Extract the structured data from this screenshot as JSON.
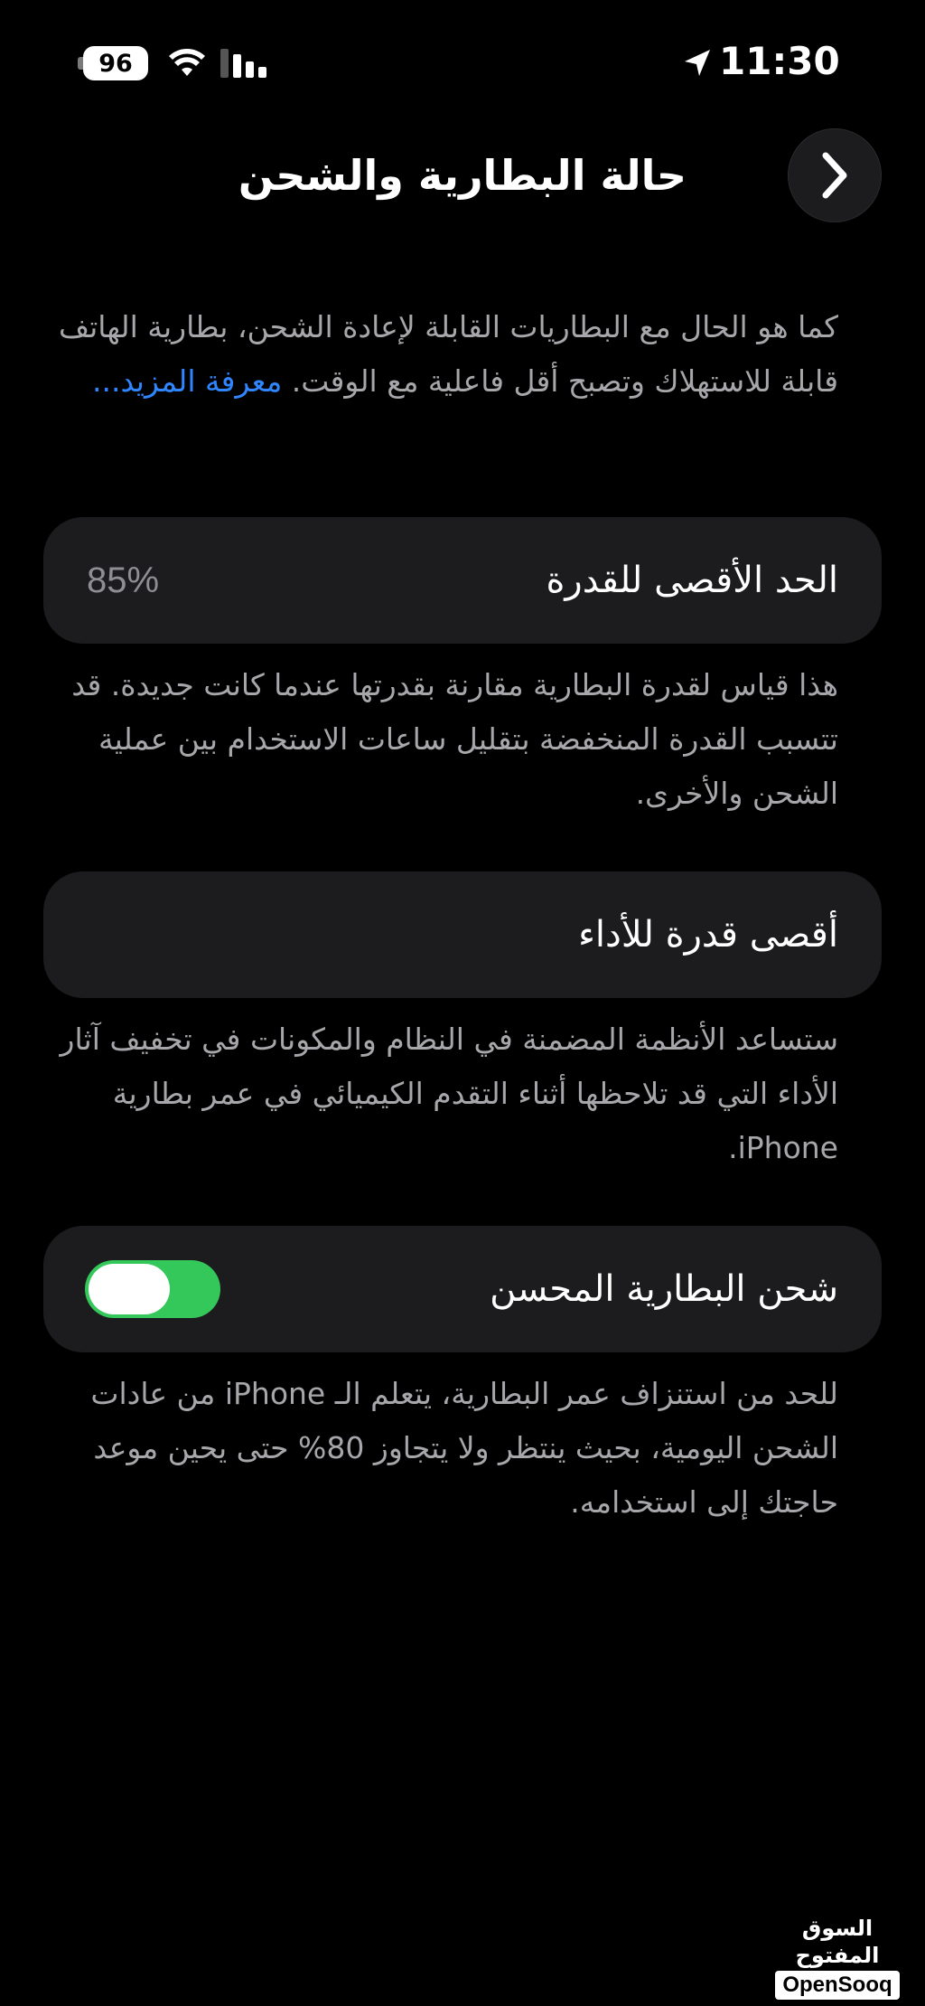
{
  "status_bar": {
    "battery_level": "96",
    "time": "11:30"
  },
  "nav": {
    "title": "حالة البطارية والشحن"
  },
  "intro": {
    "text": "كما هو الحال مع البطاريات القابلة لإعادة الشحن، بطارية الهاتف قابلة للاستهلاك وتصبح أقل فاعلية مع الوقت.",
    "learn_more": "معرفة المزيد..."
  },
  "max_capacity": {
    "label": "الحد الأقصى للقدرة",
    "value": "85%",
    "description": "هذا قياس لقدرة البطارية مقارنة بقدرتها عندما كانت جديدة. قد تتسبب القدرة المنخفضة بتقليل ساعات الاستخدام بين عملية الشحن والأخرى."
  },
  "peak_performance": {
    "label": "أقصى قدرة للأداء",
    "description": "ستساعد الأنظمة المضمنة في النظام والمكونات في تخفيف آثار الأداء التي قد تلاحظها أثناء التقدم الكيميائي في عمر بطارية iPhone."
  },
  "optimized_charging": {
    "label": "شحن البطارية المحسن",
    "enabled": true,
    "description": "للحد من استنزاف عمر البطارية، يتعلم الـ iPhone من عادات الشحن اليومية، بحيث ينتظر ولا يتجاوز 80% حتى يحين موعد حاجتك إلى استخدامه."
  },
  "watermark": {
    "arabic": "السوق المفتوح",
    "english": "OpenSooq"
  },
  "colors": {
    "background": "#000000",
    "card": "#1c1c1e",
    "secondary_text": "#a7a7ab",
    "link": "#2f86ff",
    "toggle_on": "#34c759"
  }
}
